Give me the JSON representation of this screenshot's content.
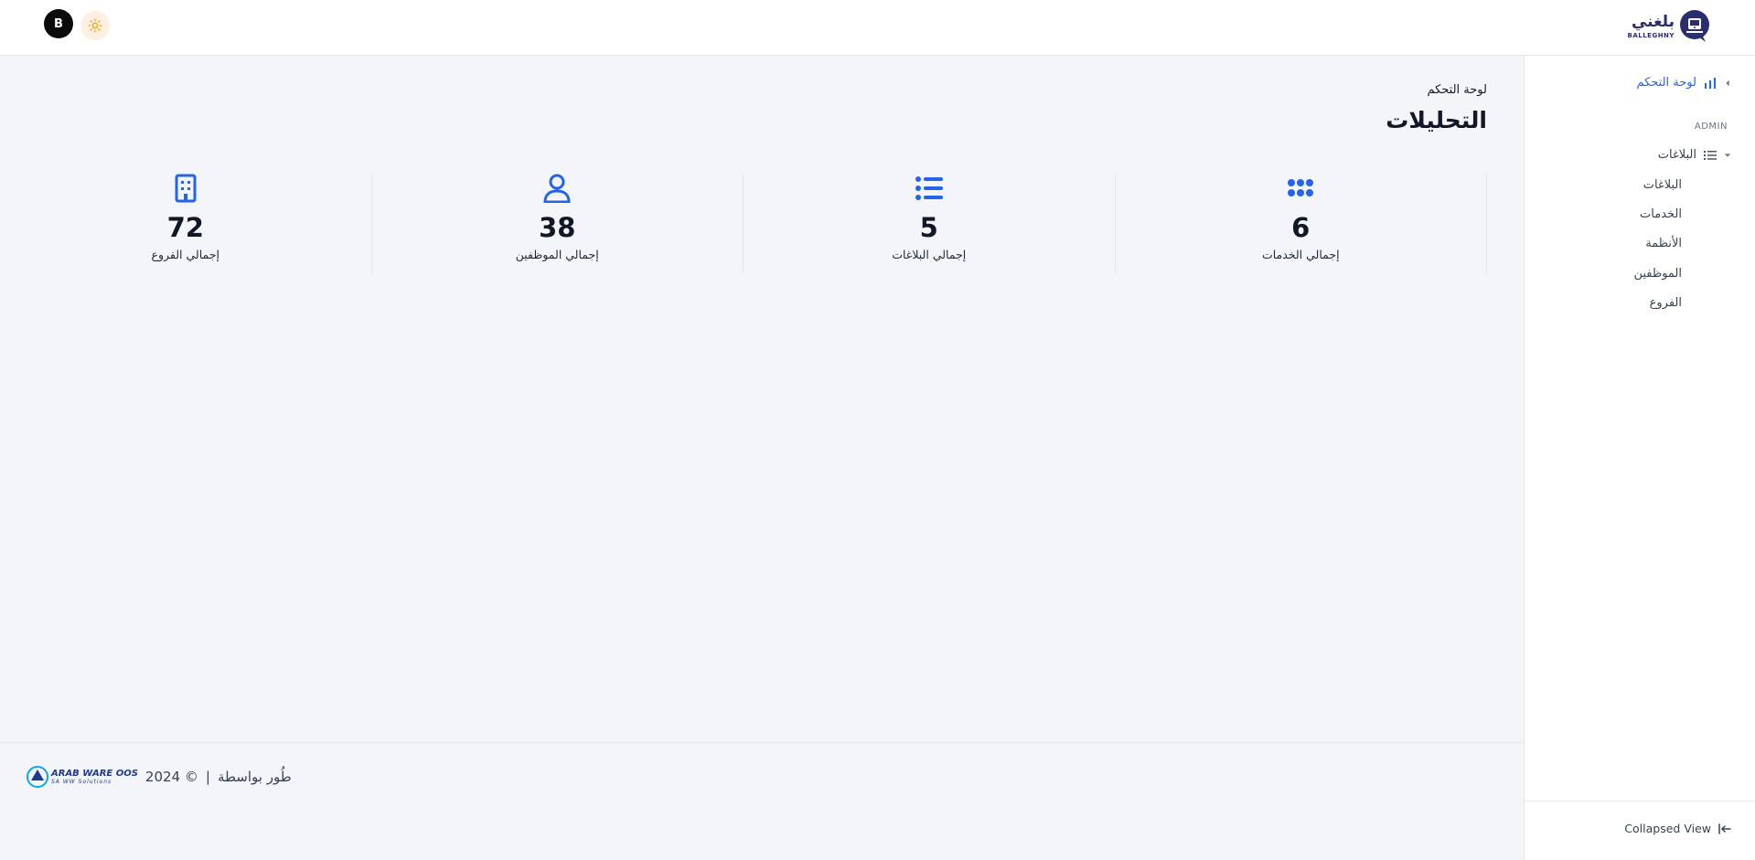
{
  "topbar": {
    "avatar_initial": "B",
    "theme_icon": "sun-icon",
    "logo": {
      "arabic": "بلغني",
      "english": "BALLEGHNY"
    }
  },
  "sidebar": {
    "dashboard_label": "لوحة التحكم",
    "section_label": "ADMIN",
    "group_label": "البلاغات",
    "items": [
      {
        "label": "البلاغات"
      },
      {
        "label": "الخدمات"
      },
      {
        "label": "الأنظمة"
      },
      {
        "label": "الموظفين"
      },
      {
        "label": "الفروع"
      }
    ],
    "collapse_label": "Collapsed View"
  },
  "main": {
    "breadcrumb": "لوحة التحكم",
    "title": "التحليلات",
    "stats": [
      {
        "value": "6",
        "label": "إجمالي الخدمات",
        "icon": "grid-dots-icon"
      },
      {
        "value": "5",
        "label": "إجمالي البلاغات",
        "icon": "list-icon"
      },
      {
        "value": "38",
        "label": "إجمالي الموظفين",
        "icon": "user-icon"
      },
      {
        "value": "72",
        "label": "إجمالي الفروع",
        "icon": "building-icon"
      }
    ]
  },
  "footer": {
    "developed_by": "طُور بواسطة",
    "separator": "|",
    "year": "2024 ©",
    "company_name": "ARAB WARE OOS",
    "company_sub": "SA  WW Solutions"
  },
  "colors": {
    "accent": "#2563eb",
    "background": "#f4f5f8",
    "logo_navy": "#2b2d6e"
  }
}
